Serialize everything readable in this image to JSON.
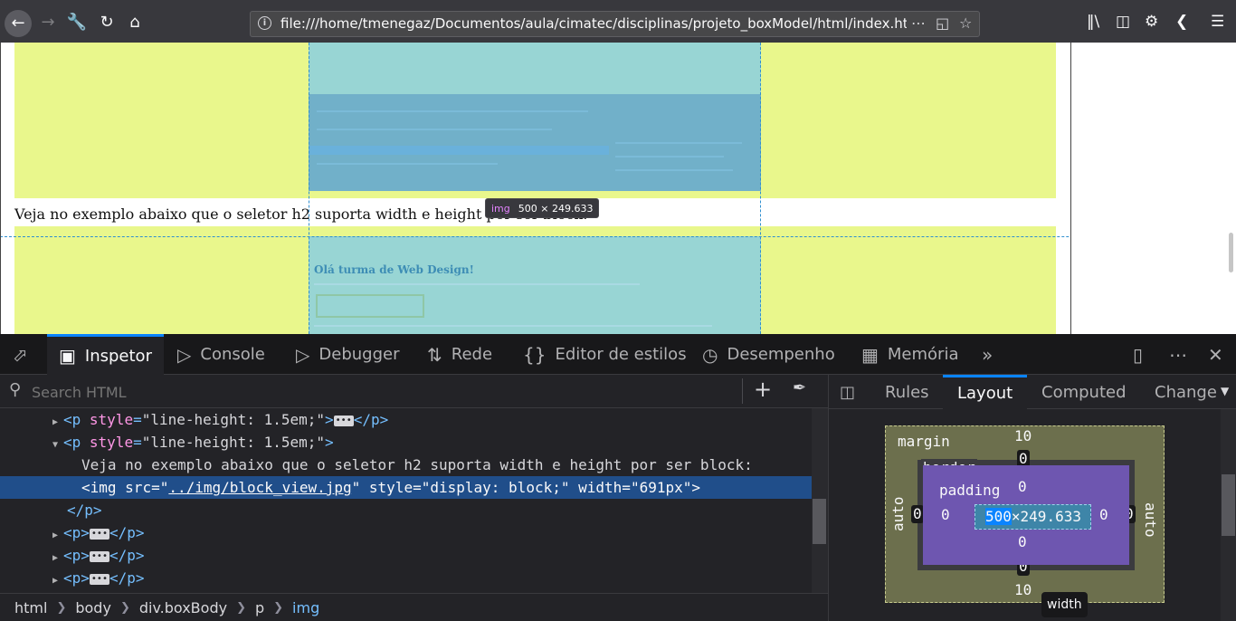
{
  "browser": {
    "url": "file:///home/tmenegaz/Documentos/aula/cimatec/disciplinas/projeto_boxModel/html/index.html"
  },
  "page": {
    "paragraph": "Veja no exemplo abaixo que o seletor h2 suporta width e height por ser block:",
    "image_tooltip": {
      "tag": "img",
      "dimensions": "500 × 249.633"
    },
    "embedded_heading": "Olá turma de Web Design!"
  },
  "devtools": {
    "tabs": [
      {
        "label": "Inspetor",
        "icon": "inspector-icon"
      },
      {
        "label": "Console",
        "icon": "console-icon"
      },
      {
        "label": "Debugger",
        "icon": "debugger-icon"
      },
      {
        "label": "Rede",
        "icon": "network-icon"
      },
      {
        "label": "Editor de estilos",
        "icon": "style-editor-icon"
      },
      {
        "label": "Desempenho",
        "icon": "performance-icon"
      },
      {
        "label": "Memória",
        "icon": "memory-icon"
      }
    ],
    "markup": {
      "search_placeholder": "Search HTML",
      "lines": {
        "p_style_attr": "style",
        "p_style_value": "\"line-height: 1.5em;\"",
        "text_content": "Veja no exemplo abaixo que o seletor h2 suporta width e height por ser block:",
        "img_src_attr": "src",
        "img_src_value": "../img/block_view.jpg",
        "img_style_attr": "style",
        "img_style_value": "\"display: block;\"",
        "img_width_attr": "width",
        "img_width_value": "\"691px\""
      }
    },
    "breadcrumbs": [
      "html",
      "body",
      "div.boxBody",
      "p",
      "img"
    ],
    "side_tabs": [
      "Rules",
      "Layout",
      "Computed",
      "Change"
    ],
    "box_model": {
      "margin_label": "margin",
      "border_label": "border",
      "padding_label": "padding",
      "margin_top": "10",
      "margin_bottom": "10",
      "margin_left": "auto",
      "margin_right": "auto",
      "border_top": "0",
      "border_bottom": "0",
      "border_left": "0",
      "border_right": "0",
      "padding_top": "0",
      "padding_bottom": "0",
      "padding_left": "0",
      "padding_right": "0",
      "content_width": "500",
      "content_height": "×249.633",
      "tooltip": "width"
    }
  }
}
